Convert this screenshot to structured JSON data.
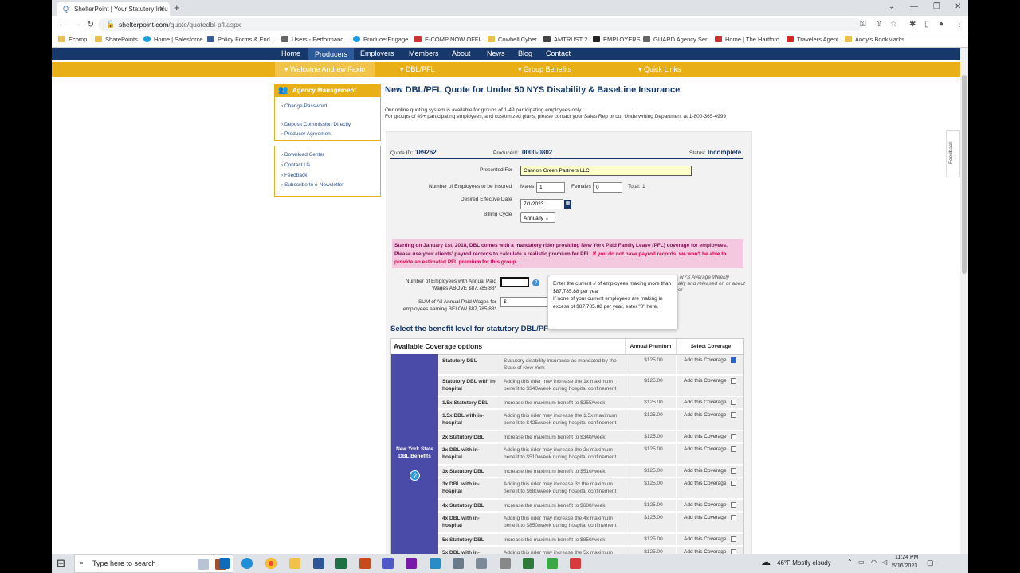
{
  "browser": {
    "tab_title": "ShelterPoint | Your Statutory Insu",
    "url_host": "shelterpoint.com",
    "url_path": "/quote/quotedbl-pfl.aspx",
    "bookmarks": [
      "Ecomp",
      "SharePoints",
      "Home | Salesforce",
      "Policy Forms & End...",
      "Users - Performanc...",
      "ProducerEngage",
      "E-COMP NOW OFFI...",
      "Cowbell Cyber",
      "AMTRUST 2",
      "EMPLOYERS",
      "GUARD Agency Ser...",
      "Home | The Hartford",
      "Travelers Agent",
      "Andy's BookMarks"
    ]
  },
  "site_nav": {
    "items": [
      "Home",
      "Producers",
      "Employers",
      "Members",
      "About",
      "News",
      "Blog",
      "Contact"
    ]
  },
  "sub_nav": {
    "welcome": "Welcome Andrew Faxio",
    "dbl_pfl": "DBL/PFL",
    "group_benefits": "Group Benefits",
    "quick_links": "Quick Links"
  },
  "sidebar": {
    "title": "Agency Management",
    "links1": [
      "Change Password",
      "Deposit Commission Directly",
      "Producer Agreement"
    ],
    "links2": [
      "Download Center",
      "Contact Us",
      "Feedback",
      "Subscribe to e-Newsletter"
    ]
  },
  "page": {
    "title": "New DBL/PFL Quote for Under 50 NYS Disability & BaseLine Insurance",
    "intro1": "Our online quoting system is available for groups of 1-49 participating employees only.",
    "intro2": "For groups of 49+ participating employees, and customized plans, please contact your Sales Rep or our Underwriting Department at 1-800-365-4999"
  },
  "quote": {
    "quote_id_label": "Quote ID:",
    "quote_id": "189262",
    "producer_label": "Producer#:",
    "producer": "0000-0802",
    "status_label": "Status:",
    "status": "Incomplete",
    "presented_for_label": "Presented For",
    "presented_for": "Cannon Green Partners LLC",
    "employees_label": "Number of Employees to be Insured",
    "males_label": "Males",
    "males": "1",
    "females_label": "Females",
    "females": "0",
    "total_label": "Total:",
    "total": "1",
    "eff_date_label": "Desired Effective Date",
    "eff_date": "7/1/2023",
    "billing_label": "Billing Cycle",
    "billing": "Annually"
  },
  "notice": {
    "text": "Starting on January 1st, 2018, DBL comes with a mandatory rider providing New York Paid Family Leave (PFL) coverage for employees. Please use your clients' payroll records to calculate a realistic premium for PFL.",
    "red": "If you do not have payroll records, we won't be able to provide an estimated PFL premium for this group."
  },
  "wages": {
    "above_label": "Number of Employees with Annual Paid Wages ABOVE $87,785.88*",
    "above_value": "",
    "below_label": "SUM of All Annual Paid Wages for employees earning BELOW $87,785.88*",
    "below_value": "$",
    "side_note1": "NYS Average Weekly",
    "side_note2": "ally and released on or about",
    "side_note3": "or"
  },
  "tooltip": {
    "line1": "Enter the current # of employees making more than $87,785.88 per year",
    "line2": "If none of your current employees are making in excess of $87,785.88 per year, enter \"0\" here."
  },
  "section_header": "Select the benefit level for statutory DBL/PF",
  "coverage": {
    "headers": {
      "options": "Available Coverage options",
      "premium": "Annual Premium",
      "select": "Select Coverage"
    },
    "band": "New York State DBL Benefits",
    "add_label": "Add this Coverage",
    "rows": [
      {
        "name": "Statutory DBL",
        "desc": "Statutory disability insurance as mandated by the State of New York",
        "premium": "$125.00",
        "checked": true
      },
      {
        "name": "Statutory DBL with in-hospital",
        "desc": "Adding this rider may increase the 1x maximum benefit to $340/week during hospital confinement",
        "premium": "$125.00",
        "checked": false
      },
      {
        "name": "1.5x Statutory DBL",
        "desc": "Increase the maximum benefit to $255/week",
        "premium": "$125.00",
        "checked": false
      },
      {
        "name": "1.5x DBL with in-hospital",
        "desc": "Adding this rider may increase the 1.5x maximum benefit to $425/week during hospital confinement",
        "premium": "$125.00",
        "checked": false
      },
      {
        "name": "2x Statutory DBL",
        "desc": "Increase the maximum benefit to $340/week",
        "premium": "$125.00",
        "checked": false
      },
      {
        "name": "2x DBL with in-hospital",
        "desc": "Adding this rider may increase the 2x maximum benefit to $510/week during hospital confinement",
        "premium": "$125.00",
        "checked": false
      },
      {
        "name": "3x Statutory DBL",
        "desc": "Increase the maximum benefit to $510/week",
        "premium": "$125.00",
        "checked": false
      },
      {
        "name": "3x DBL with in-hospital",
        "desc": "Adding this rider may increase 3x the maximum benefit to $680/week during hospital confinement",
        "premium": "$125.00",
        "checked": false
      },
      {
        "name": "4x Statutory DBL",
        "desc": "Increase the maximum benefit to $680/week",
        "premium": "$125.00",
        "checked": false
      },
      {
        "name": "4x DBL with in-hospital",
        "desc": "Adding this rider may increase the 4x maximum benefit to $850/week during hospital confinement",
        "premium": "$125.00",
        "checked": false
      },
      {
        "name": "5x Statutory DBL",
        "desc": "Increase the maximum benefit to $850/week",
        "premium": "$125.00",
        "checked": false
      },
      {
        "name": "5x DBL with in-",
        "desc": "Adding this rider may increase the 5x maximum",
        "premium": "$125.00",
        "checked": false
      }
    ]
  },
  "feedback_tab": "Feedback",
  "taskbar": {
    "search": "Type here to search",
    "weather": "46°F  Mostly cloudy",
    "time": "11:24 PM",
    "date": "5/16/2023"
  }
}
